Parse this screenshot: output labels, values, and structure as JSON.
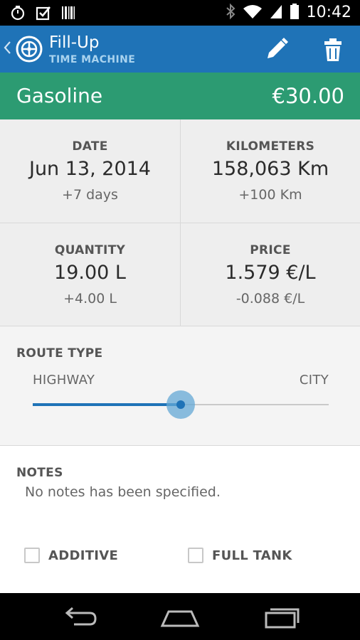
{
  "status_bar": {
    "time": "10:42",
    "left_icons": [
      "stopwatch-icon",
      "checkbox-icon",
      "barcode-icon"
    ],
    "right_icons": [
      "bluetooth-icon",
      "wifi-icon",
      "signal-icon",
      "battery-icon"
    ]
  },
  "app_bar": {
    "title": "Fill-Up",
    "subtitle": "TIME MACHINE",
    "actions": [
      "edit-icon",
      "delete-icon"
    ],
    "color": "#1f73b7"
  },
  "fuel": {
    "type": "Gasoline",
    "amount": "€30.00",
    "color": "#2c9b72"
  },
  "stats": {
    "date": {
      "label": "DATE",
      "value": "Jun 13, 2014",
      "delta": "+7 days"
    },
    "kilometers": {
      "label": "KILOMETERS",
      "value": "158,063 Km",
      "delta": "+100 Km"
    },
    "quantity": {
      "label": "QUANTITY",
      "value": "19.00 L",
      "delta": "+4.00 L"
    },
    "price": {
      "label": "PRICE",
      "value": "1.579 €/L",
      "delta": "-0.088 €/L"
    }
  },
  "route": {
    "title": "ROUTE TYPE",
    "min_label": "HIGHWAY",
    "max_label": "CITY",
    "value_fraction": 0.5
  },
  "notes": {
    "title": "NOTES",
    "text": "No notes has been specified."
  },
  "options": {
    "additive": {
      "label": "ADDITIVE",
      "checked": false
    },
    "full_tank": {
      "label": "FULL TANK",
      "checked": false
    }
  },
  "nav": [
    "back-icon",
    "home-icon",
    "recent-apps-icon"
  ]
}
